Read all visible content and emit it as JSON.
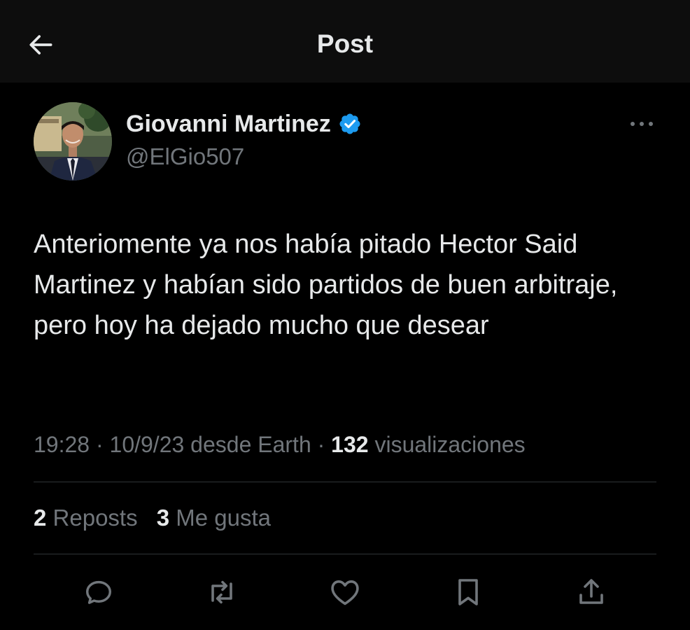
{
  "header": {
    "title": "Post",
    "back_icon": "arrow-left-icon"
  },
  "post": {
    "author_name": "Giovanni Martinez",
    "author_handle": "@ElGio507",
    "verified": true,
    "verified_color": "#1d9bf0",
    "text": "Anteriomente ya nos había pitado Hector Said Martinez y habían sido partidos de buen arbitraje, pero hoy ha dejado mucho que desear",
    "time": "19:28",
    "separator": "·",
    "date": "10/9/23",
    "source": "desde Earth",
    "views_count": "132",
    "views_label": "visualizaciones"
  },
  "stats": {
    "reposts_count": "2",
    "reposts_label": "Reposts",
    "likes_count": "3",
    "likes_label": "Me gusta"
  },
  "actions": [
    {
      "icon": "reply-icon"
    },
    {
      "icon": "repost-icon"
    },
    {
      "icon": "like-icon"
    },
    {
      "icon": "bookmark-icon"
    },
    {
      "icon": "share-icon"
    }
  ],
  "colors": {
    "background": "#000000",
    "header_background": "#0d0d0d",
    "text_primary": "#e7e9ea",
    "text_secondary": "#71767b",
    "divider": "#2f3336"
  }
}
